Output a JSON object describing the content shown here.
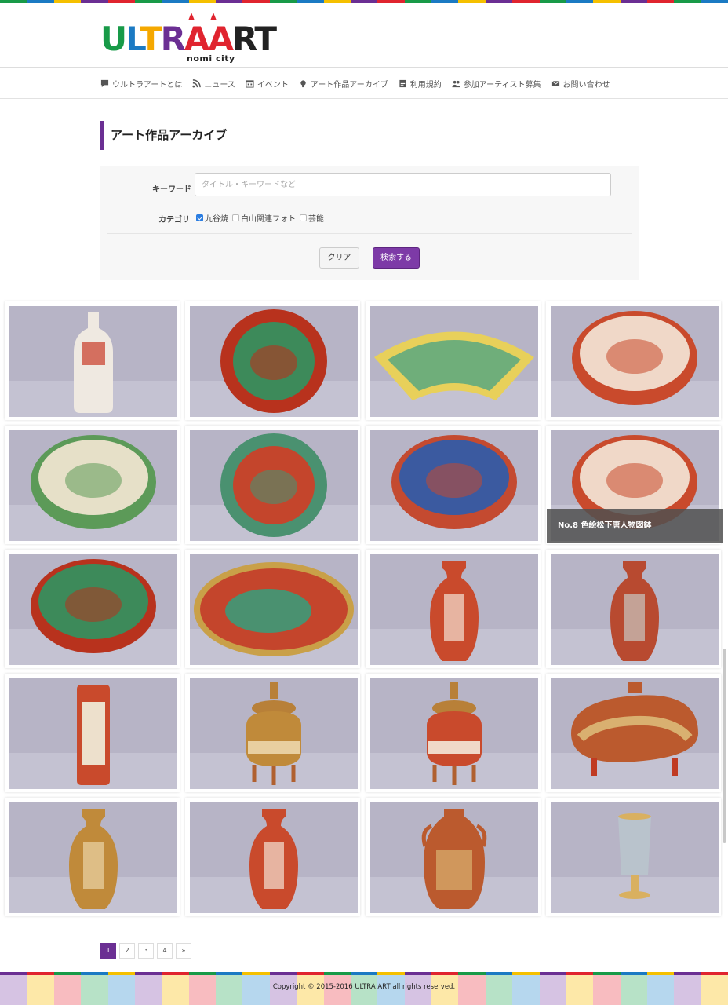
{
  "brand": {
    "logo_text": "ULTRAART",
    "logo_sub": "nomi city",
    "colors": {
      "purple": "#6b2f93",
      "green": "#189a48",
      "blue": "#1b7ac3",
      "red": "#e0242f",
      "yellow": "#f5c000"
    }
  },
  "nav": {
    "items": [
      {
        "label": "ウルトラアートとは",
        "icon": "speech-bubble-icon"
      },
      {
        "label": "ニュース",
        "icon": "rss-icon"
      },
      {
        "label": "イベント",
        "icon": "calendar-icon"
      },
      {
        "label": "アート作品アーカイブ",
        "icon": "lightbulb-icon"
      },
      {
        "label": "利用規約",
        "icon": "document-icon"
      },
      {
        "label": "参加アーティスト募集",
        "icon": "people-icon"
      },
      {
        "label": "お問い合わせ",
        "icon": "mail-icon"
      }
    ]
  },
  "page": {
    "title": "アート作品アーカイブ"
  },
  "search": {
    "keyword_label": "キーワード",
    "keyword_placeholder": "タイトル・キーワードなど",
    "keyword_value": "",
    "category_label": "カテゴリ",
    "categories": [
      {
        "label": "九谷焼",
        "checked": true
      },
      {
        "label": "白山関連フォト",
        "checked": false
      },
      {
        "label": "芸能",
        "checked": false
      }
    ],
    "clear_label": "クリア",
    "submit_label": "検索する"
  },
  "gallery": {
    "hover_caption": "No.8 色絵松下唐人物図鉢",
    "items": [
      {
        "shape": "bottle",
        "palette": "white-red"
      },
      {
        "shape": "plate",
        "palette": "red-green"
      },
      {
        "shape": "fan",
        "palette": "yellow-green"
      },
      {
        "shape": "bowl",
        "palette": "red"
      },
      {
        "shape": "bowl",
        "palette": "green"
      },
      {
        "shape": "plate",
        "palette": "green-red"
      },
      {
        "shape": "bowl",
        "palette": "red-blue"
      },
      {
        "shape": "bowl",
        "palette": "red"
      },
      {
        "shape": "bowl",
        "palette": "red-green"
      },
      {
        "shape": "oval",
        "palette": "green-red"
      },
      {
        "shape": "vase",
        "palette": "red"
      },
      {
        "shape": "vase",
        "palette": "red-silver"
      },
      {
        "shape": "cylinder",
        "palette": "red"
      },
      {
        "shape": "censer",
        "palette": "gold"
      },
      {
        "shape": "censer",
        "palette": "red"
      },
      {
        "shape": "jar",
        "palette": "red-gold"
      },
      {
        "shape": "vase",
        "palette": "gold"
      },
      {
        "shape": "vase",
        "palette": "red"
      },
      {
        "shape": "amphora",
        "palette": "red-gold"
      },
      {
        "shape": "cup",
        "palette": "grey"
      }
    ]
  },
  "pagination": {
    "pages": [
      "1",
      "2",
      "3",
      "4",
      "»"
    ],
    "current": "1"
  },
  "footer": {
    "copyright": "Copyright © 2015-2016 ULTRA ART all rights reserved."
  }
}
